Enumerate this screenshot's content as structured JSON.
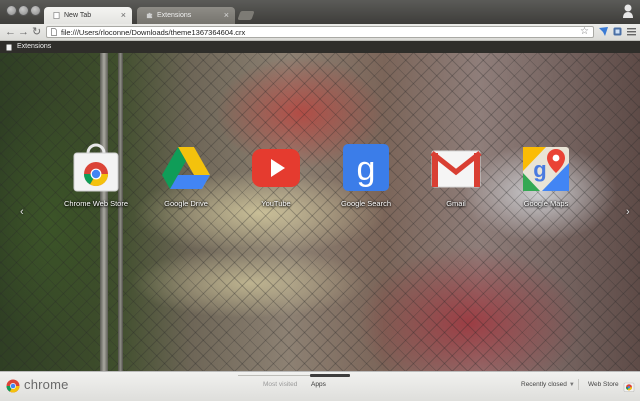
{
  "tabs": [
    {
      "label": "New Tab",
      "active": true
    },
    {
      "label": "Extensions",
      "active": false
    }
  ],
  "toolbar": {
    "url": "file:///Users/rloconne/Downloads/theme1367364604.crx"
  },
  "bookmarks": {
    "items": [
      {
        "label": "Extensions"
      }
    ]
  },
  "apps": [
    {
      "label": "Chrome Web Store",
      "icon": "chrome-web-store-icon"
    },
    {
      "label": "Google Drive",
      "icon": "google-drive-icon"
    },
    {
      "label": "YouTube",
      "icon": "youtube-icon"
    },
    {
      "label": "Google Search",
      "icon": "google-search-icon"
    },
    {
      "label": "Gmail",
      "icon": "gmail-icon"
    },
    {
      "label": "Google Maps",
      "icon": "google-maps-icon"
    }
  ],
  "footer": {
    "brand": "chrome",
    "nav": [
      {
        "label": "Most visited",
        "selected": false
      },
      {
        "label": "Apps",
        "selected": true
      }
    ],
    "recently_closed": "Recently closed",
    "web_store": "Web Store"
  },
  "colors": {
    "youtube_red": "#e53b2f",
    "gmail_red": "#d93f33",
    "google_blue": "#3b7de9",
    "drive_green": "#0f9d58",
    "drive_yellow": "#f4c20d"
  }
}
